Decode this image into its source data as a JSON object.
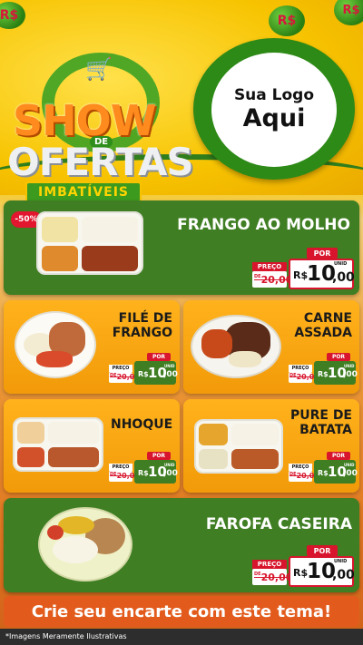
{
  "header": {
    "title_line1": "SHOW",
    "title_de": "DE",
    "title_line2": "OFERTAS",
    "title_line3": "IMBATÍVEIS",
    "logo_line1": "Sua Logo",
    "logo_line2": "Aqui",
    "coin_symbol": "R$"
  },
  "products": [
    {
      "name": "FRANGO AO MOLHO",
      "badge": "-50%",
      "por": "POR",
      "preco": "PREÇO",
      "de": "DE",
      "old_price": "20,00",
      "currency": "R$",
      "price_int": "10",
      "price_dec": ",00",
      "unit": "UNID"
    },
    {
      "name": "FILÉ DE FRANGO",
      "por": "POR",
      "preco": "PREÇO",
      "de": "DE",
      "old_price": "20,00",
      "currency": "R$",
      "price_int": "10",
      "price_dec": ",00",
      "unit": "UNID"
    },
    {
      "name": "CARNE ASSADA",
      "por": "POR",
      "preco": "PREÇO",
      "de": "DE",
      "old_price": "20,00",
      "currency": "R$",
      "price_int": "10",
      "price_dec": ",00",
      "unit": "UNID"
    },
    {
      "name": "NHOQUE",
      "por": "POR",
      "preco": "PREÇO",
      "de": "DE",
      "old_price": "20,00",
      "currency": "R$",
      "price_int": "10",
      "price_dec": ",00",
      "unit": "UNID"
    },
    {
      "name": "PURE DE BATATA",
      "por": "POR",
      "preco": "PREÇO",
      "de": "DE",
      "old_price": "20,00",
      "currency": "R$",
      "price_int": "10",
      "price_dec": ",00",
      "unit": "UNID"
    },
    {
      "name": "FAROFA CASEIRA",
      "por": "POR",
      "preco": "PREÇO",
      "de": "DE",
      "old_price": "20,00",
      "currency": "R$",
      "price_int": "10",
      "price_dec": ",00",
      "unit": "UNID"
    }
  ],
  "cta": {
    "label": "Crie seu encarte com este tema!"
  },
  "footer": {
    "disclaimer": "*Imagens Meramente Ilustrativas"
  },
  "colors": {
    "green": "#3f7e23",
    "orange": "#f7a516",
    "red": "#d8152c",
    "yellow": "#f6c400",
    "cta": "#e25b1c"
  }
}
